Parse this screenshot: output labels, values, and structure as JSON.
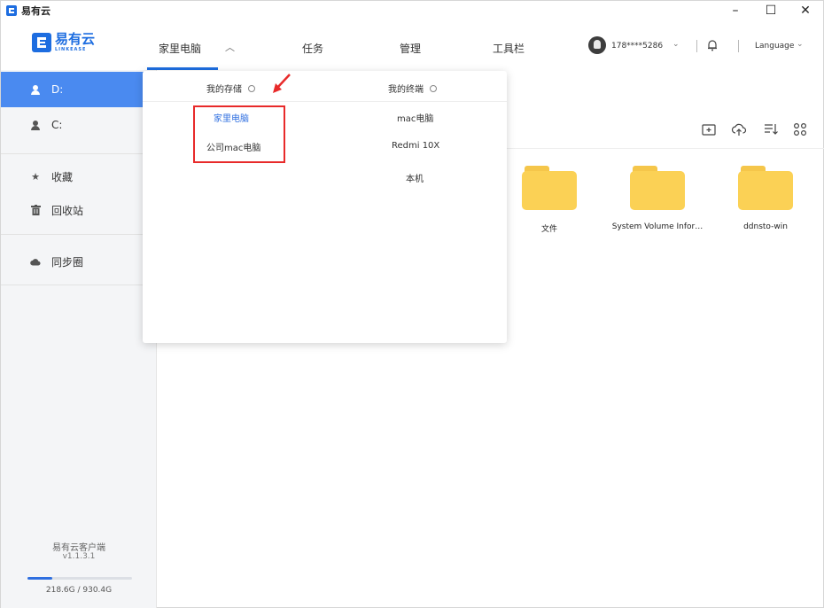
{
  "window": {
    "title": "易有云"
  },
  "brand": {
    "name": "易有云",
    "sub": "LINKEASE"
  },
  "nav": {
    "items": [
      "家里电脑",
      "任务",
      "管理",
      "工具栏"
    ],
    "caret": "^"
  },
  "user": {
    "phone": "178****5286",
    "caret": "⌄",
    "language": "Language"
  },
  "sidebar": {
    "drives": [
      "D:",
      "C:"
    ],
    "favorites": "收藏",
    "recycle": "回收站",
    "sync": "同步圈",
    "client_name": "易有云客户端",
    "client_version": "v1.1.3.1",
    "storage_text": "218.6G / 930.4G",
    "storage_used_fraction": 0.235
  },
  "files": [
    {
      "name": "文件"
    },
    {
      "name": "System Volume Infor…"
    },
    {
      "name": "ddnsto-win"
    }
  ],
  "dropdown": {
    "left_header": "我的存储",
    "right_header": "我的终端",
    "storage_items": [
      "家里电脑",
      "公司mac电脑"
    ],
    "terminal_items": [
      "mac电脑",
      "Redmi 10X",
      "本机"
    ]
  },
  "colors": {
    "accent": "#1d6de0",
    "sidebar_active": "#4a8af0",
    "folder": "#fbd155",
    "highlight": "#e82a2a"
  }
}
